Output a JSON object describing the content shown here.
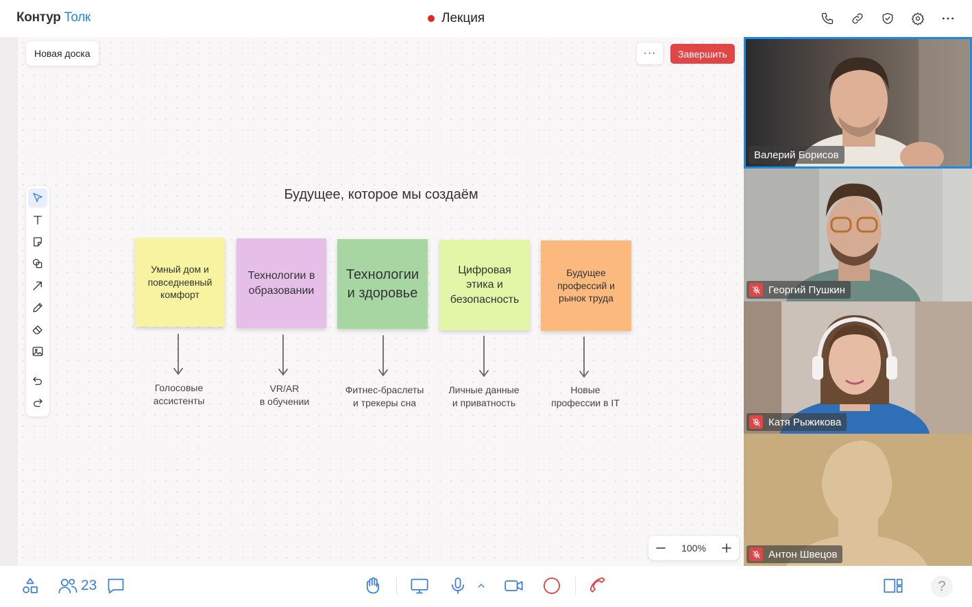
{
  "header": {
    "brand": "Контур",
    "product": "Толк",
    "meeting_title": "Лекция",
    "icons": [
      "phone-icon",
      "link-icon",
      "shield-icon",
      "gear-icon",
      "more-icon"
    ]
  },
  "board": {
    "name": "Новая доска",
    "more_label": "···",
    "finish_label": "Завершить",
    "title": "Будущее, которое мы создаём",
    "tools": [
      "select-icon",
      "text-icon",
      "sticker-icon",
      "shapes-icon",
      "arrow-icon",
      "pen-icon",
      "eraser-icon",
      "image-icon",
      "undo-icon",
      "redo-icon"
    ],
    "stickies": [
      {
        "text": "Умный дом и повседневный комфорт",
        "color": "#f8f3a0"
      },
      {
        "text": "Технологии в образовании",
        "color": "#e6bfe8"
      },
      {
        "text": "Технологии и здоровье",
        "color": "#a8d6a2"
      },
      {
        "text": "Цифровая этика и безопасность",
        "color": "#e3f6a8"
      },
      {
        "text": "Будущее профессий и рынок труда",
        "color": "#fbb97e"
      }
    ],
    "captions": [
      {
        "line1": "Голосовые",
        "line2": "ассистенты"
      },
      {
        "line1": "VR/AR",
        "line2": "в обучении"
      },
      {
        "line1": "Фитнес-браслеты",
        "line2": "и трекеры сна"
      },
      {
        "line1": "Личные данные",
        "line2": "и приватность"
      },
      {
        "line1": "Новые",
        "line2": "профессии в IT"
      }
    ],
    "zoom": "100%"
  },
  "participants": [
    {
      "name": "Валерий Борисов",
      "muted": false,
      "active_speaker": true
    },
    {
      "name": "Георгий Пушкин",
      "muted": true,
      "active_speaker": false
    },
    {
      "name": "Катя Рыжикова",
      "muted": true,
      "active_speaker": false
    },
    {
      "name": "Антон Швецов",
      "muted": true,
      "active_speaker": false,
      "camera_off": true
    }
  ],
  "bottom_bar": {
    "participants_count": "23",
    "help_label": "?"
  },
  "colors": {
    "accent": "#3a7fe0",
    "danger": "#e04646",
    "active_border": "#1e88e5"
  }
}
